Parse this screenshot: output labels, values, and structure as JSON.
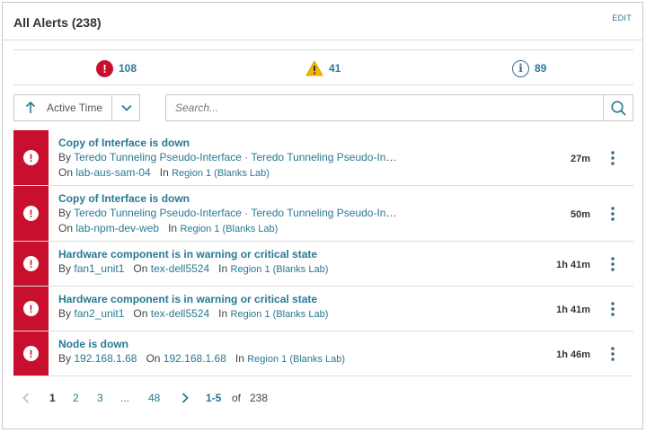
{
  "header": {
    "title": "All Alerts (238)",
    "edit_label": "EDIT"
  },
  "summary": {
    "critical": "108",
    "warning": "41",
    "info": "89"
  },
  "sort": {
    "label": "Active Time"
  },
  "search": {
    "placeholder": "Search...",
    "value": ""
  },
  "labels": {
    "by": "By",
    "on": "On",
    "in": "In"
  },
  "alerts": [
    {
      "title": "Copy of Interface is down",
      "by": "Teredo Tunneling Pseudo-Interface · Teredo Tunneling Pseudo-Interface",
      "on": "lab-aus-sam-04",
      "region": "Region 1 (Blanks Lab)",
      "time": "27m"
    },
    {
      "title": "Copy of Interface is down",
      "by": "Teredo Tunneling Pseudo-Interface · Teredo Tunneling Pseudo-Interface",
      "on": "lab-npm-dev-web",
      "region": "Region 1 (Blanks Lab)",
      "time": "50m"
    },
    {
      "title": "Hardware component is in warning or critical state",
      "by": "fan1_unit1",
      "on": "tex-dell5524",
      "region": "Region 1 (Blanks Lab)",
      "time": "1h 41m"
    },
    {
      "title": "Hardware component is in warning or critical state",
      "by": "fan2_unit1",
      "on": "tex-dell5524",
      "region": "Region 1 (Blanks Lab)",
      "time": "1h 41m"
    },
    {
      "title": "Node is down",
      "by": "192.168.1.68",
      "on": "192.168.1.68",
      "region": "Region 1 (Blanks Lab)",
      "time": "1h 46m"
    }
  ],
  "pagination": {
    "pages": [
      "1",
      "2",
      "3",
      "...",
      "48"
    ],
    "range": "1-5",
    "of": "of",
    "total": "238"
  },
  "colors": {
    "critical": "#c8102e",
    "warning": "#f5b400",
    "info": "#3d6b86",
    "link": "#297994"
  }
}
